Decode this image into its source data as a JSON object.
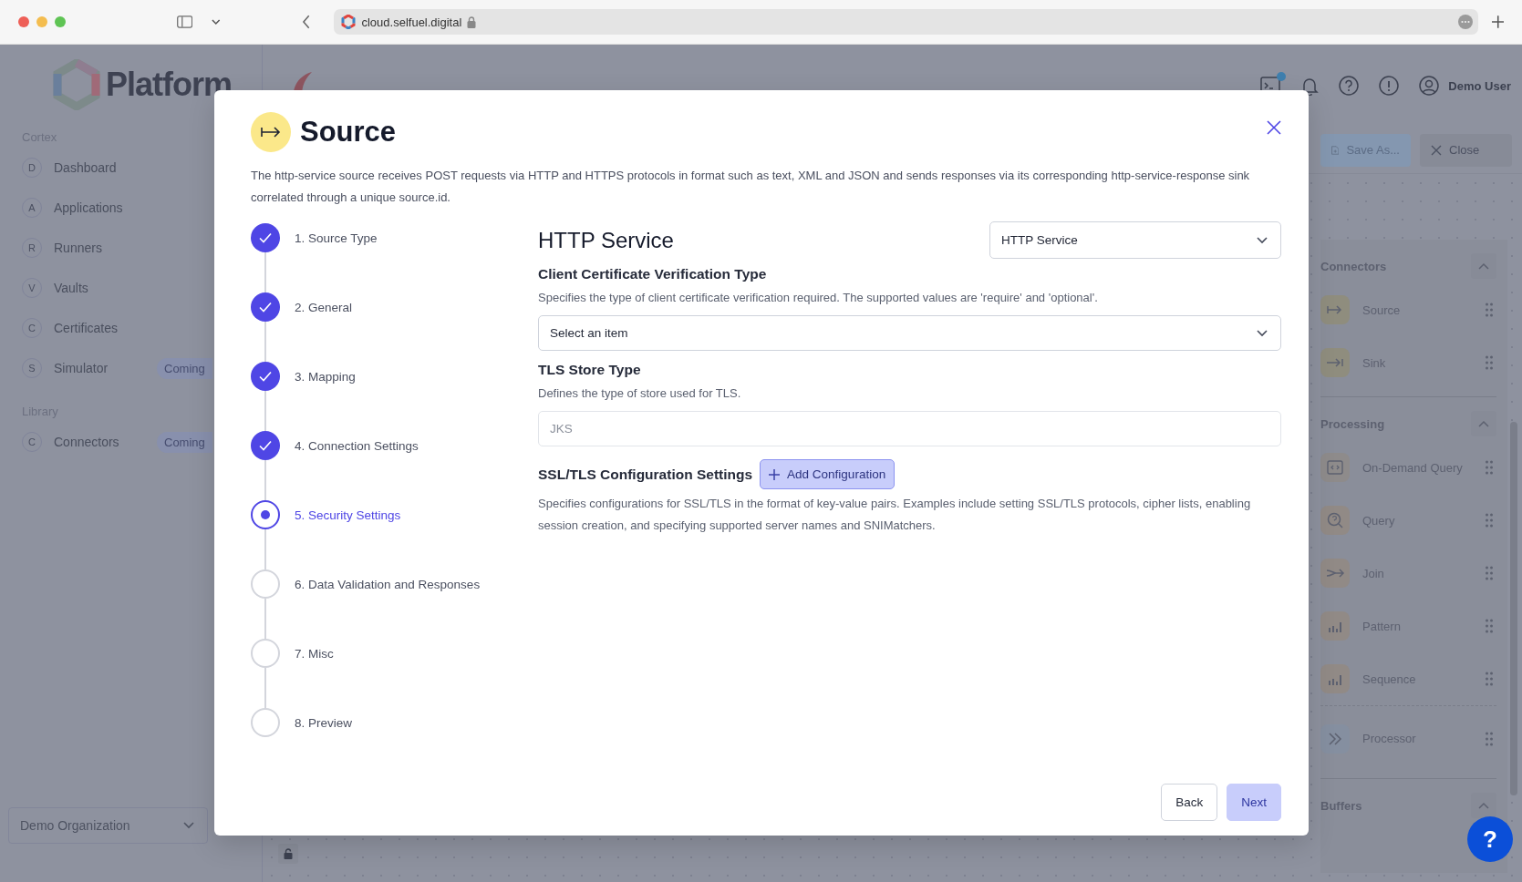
{
  "browser": {
    "url": "cloud.selfuel.digital"
  },
  "sidebar": {
    "brand": "Platform",
    "sections": [
      {
        "title": "Cortex",
        "items": [
          {
            "badge": "D",
            "label": "Dashboard"
          },
          {
            "badge": "A",
            "label": "Applications"
          },
          {
            "badge": "R",
            "label": "Runners"
          },
          {
            "badge": "V",
            "label": "Vaults"
          },
          {
            "badge": "C",
            "label": "Certificates"
          },
          {
            "badge": "S",
            "label": "Simulator",
            "tag": "Coming"
          }
        ]
      },
      {
        "title": "Library",
        "items": [
          {
            "badge": "C",
            "label": "Connectors",
            "tag": "Coming"
          }
        ]
      }
    ],
    "organization": "Demo Organization"
  },
  "header": {
    "terminal_badge": true,
    "user": "Demo User"
  },
  "toolbar": {
    "buttons": [
      {
        "label": "Save As...",
        "kind": "save_as"
      },
      {
        "label": "Close",
        "kind": "close"
      }
    ]
  },
  "palette": {
    "sections": [
      {
        "title": "Connectors",
        "expanded": true,
        "items": [
          {
            "label": "Source",
            "kind": "source",
            "color": "#8f8d7e"
          },
          {
            "label": "Sink",
            "kind": "sink",
            "color": "#8f8d7e"
          }
        ]
      },
      {
        "title": "Processing",
        "expanded": true,
        "items": [
          {
            "label": "On-Demand Query",
            "kind": "code",
            "color": "#8e8b8b"
          },
          {
            "label": "Query",
            "kind": "search",
            "color": "#918a86"
          },
          {
            "label": "Join",
            "kind": "join",
            "color": "#918a86"
          },
          {
            "label": "Pattern",
            "kind": "bars",
            "color": "#918a86"
          },
          {
            "label": "Sequence",
            "kind": "bars",
            "color": "#918a86"
          },
          {
            "label": "Processor",
            "kind": "processor",
            "color": "#858fa0"
          }
        ]
      },
      {
        "title": "Buffers",
        "expanded": true
      }
    ]
  },
  "help_button": "?",
  "modal": {
    "title": "Source",
    "description": "The http-service source receives POST requests via HTTP and HTTPS protocols in format such as text, XML and JSON and sends responses via its corresponding http-service-response sink correlated through a unique source.id.",
    "steps": [
      {
        "label": "1. Source Type",
        "completed": true,
        "selected": false
      },
      {
        "label": "2. General",
        "completed": true,
        "selected": false
      },
      {
        "label": "3. Mapping",
        "completed": true,
        "selected": false
      },
      {
        "label": "4. Connection Settings",
        "completed": true,
        "selected": false
      },
      {
        "label": "5. Security Settings",
        "completed": false,
        "selected": true
      },
      {
        "label": "6. Data Validation and Responses",
        "completed": false,
        "selected": false
      },
      {
        "label": "7. Misc",
        "completed": false,
        "selected": false
      },
      {
        "label": "8. Preview",
        "completed": false,
        "selected": false
      }
    ],
    "form": {
      "title": "HTTP Service",
      "type_select": "HTTP Service",
      "fields": [
        {
          "kind": "select",
          "label": "Client Certificate Verification Type",
          "description": "Specifies the type of client certificate verification required. The supported values are 'require' and 'optional'.",
          "placeholder": "Select an item"
        },
        {
          "kind": "input",
          "label": "TLS Store Type",
          "description": "Defines the type of store used for TLS.",
          "placeholder": "JKS"
        },
        {
          "kind": "config",
          "label": "SSL/TLS Configuration Settings",
          "button": "Add Configuration",
          "description": "Specifies configurations for SSL/TLS in the format of key-value pairs. Examples include setting SSL/TLS protocols, cipher lists, enabling session creation, and specifying supported server names and SNIMatchers."
        }
      ]
    },
    "buttons": [
      {
        "label": "Back",
        "kind": "secondary"
      },
      {
        "label": "Next",
        "kind": "primary"
      }
    ]
  }
}
